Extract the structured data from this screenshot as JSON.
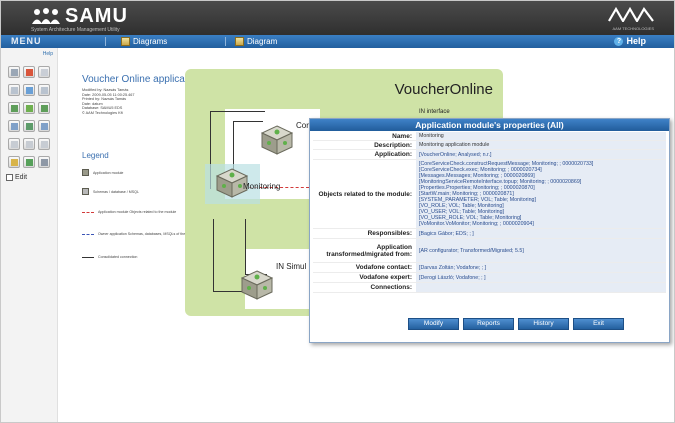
{
  "app": {
    "title": "SAMU",
    "subtitle": "System Architecture Management Utility",
    "vendor_sub": "AAM TECHNOLOGIES"
  },
  "menubar": {
    "menu_label": "MENU",
    "tabs": [
      {
        "label": "Diagrams"
      },
      {
        "label": "Diagram"
      }
    ],
    "help_label": "Help"
  },
  "sidebar": {
    "help_link": "Help",
    "edit_label": "Edit"
  },
  "document": {
    "title": "Voucher Online application",
    "meta": [
      "Modified by: Nazsás Tamás",
      "Date: 2009-05-05 11:00:25.467",
      "Printed by: Nazsás Tamás",
      "Date: datum",
      "Database: SAMU5 EDS",
      "© AAM Technologies Kft"
    ]
  },
  "legend": {
    "title": "Legend",
    "items": [
      "Application module",
      "Schemas / database / MSQL",
      "Application module Objects related to the module",
      "Owner application Schemas, databases, MSQLs of the given application",
      "Consolidated connection"
    ]
  },
  "diagram": {
    "title": "VoucherOnline",
    "nodes": [
      {
        "label": "Cor"
      },
      {
        "label": "Monitoring"
      },
      {
        "label": "IN Simul"
      }
    ],
    "interface_label": "IN interface"
  },
  "dialog": {
    "title": "Application module's properties (All)",
    "rows": {
      "name": {
        "label": "Name:",
        "value": "Monitoring"
      },
      "description": {
        "label": "Description:",
        "value": "Monitoring application module"
      },
      "application": {
        "label": "Application:",
        "value": "[VoucherOnline; Analysed; n.r.]"
      },
      "objects": {
        "label": "Objects related to the module:",
        "values": [
          "[CoreServiceCheck.constructRequestMessage; Monitoring; ; 0000020733]",
          "[CoreServiceCheck.exec; Monitoring; ; 0000020734]",
          "[Messages.Messages; Monitoring; ; 0000020869]",
          "[MonitoringServiceRemoteInterface.topup; Monitoring; ; 0000020869]",
          "[Properties.Properties; Monitoring; ; 0000020870]",
          "[StartW.main; Monitoring; ; 0000020871]",
          "[SYSTEM_PARAMETER; VOL; Table; Monitoring]",
          "[VO_ROLE; VOL; Table; Monitoring]",
          "[VO_USER; VOL; Table; Monitoring]",
          "[VO_USER_ROLE; VOL; Table; Monitoring]",
          "[VoMonitor.VoMonitor; Monitoring; ; 0000020904]"
        ]
      },
      "responsibles": {
        "label": "Responsibles:",
        "value": "[Bagics Gábor; EDS; ; ]"
      },
      "transformed": {
        "label": "Application transformed/migrated from:",
        "value": "[AR configurator; Transformed/Migrated; 5.5]"
      },
      "vodafone_contact": {
        "label": "Vodafone contact:",
        "value": "[Darvas Zoltán; Vodafone; ; ]"
      },
      "vodafone_expert": {
        "label": "Vodafone expert:",
        "value": "[Derogi László; Vodafone; ; ]"
      },
      "connections": {
        "label": "Connections:",
        "value": ""
      }
    },
    "buttons": {
      "modify": "Modify",
      "reports": "Reports",
      "history": "History",
      "exit": "Exit"
    }
  },
  "colors": {
    "header_bg": "#3a3a3a",
    "menubar_bg": "#2e6fb0",
    "diagram_bg": "#cfe3a6",
    "link_blue": "#2a4d8f",
    "dialog_title_bg": "#2f6fae"
  }
}
